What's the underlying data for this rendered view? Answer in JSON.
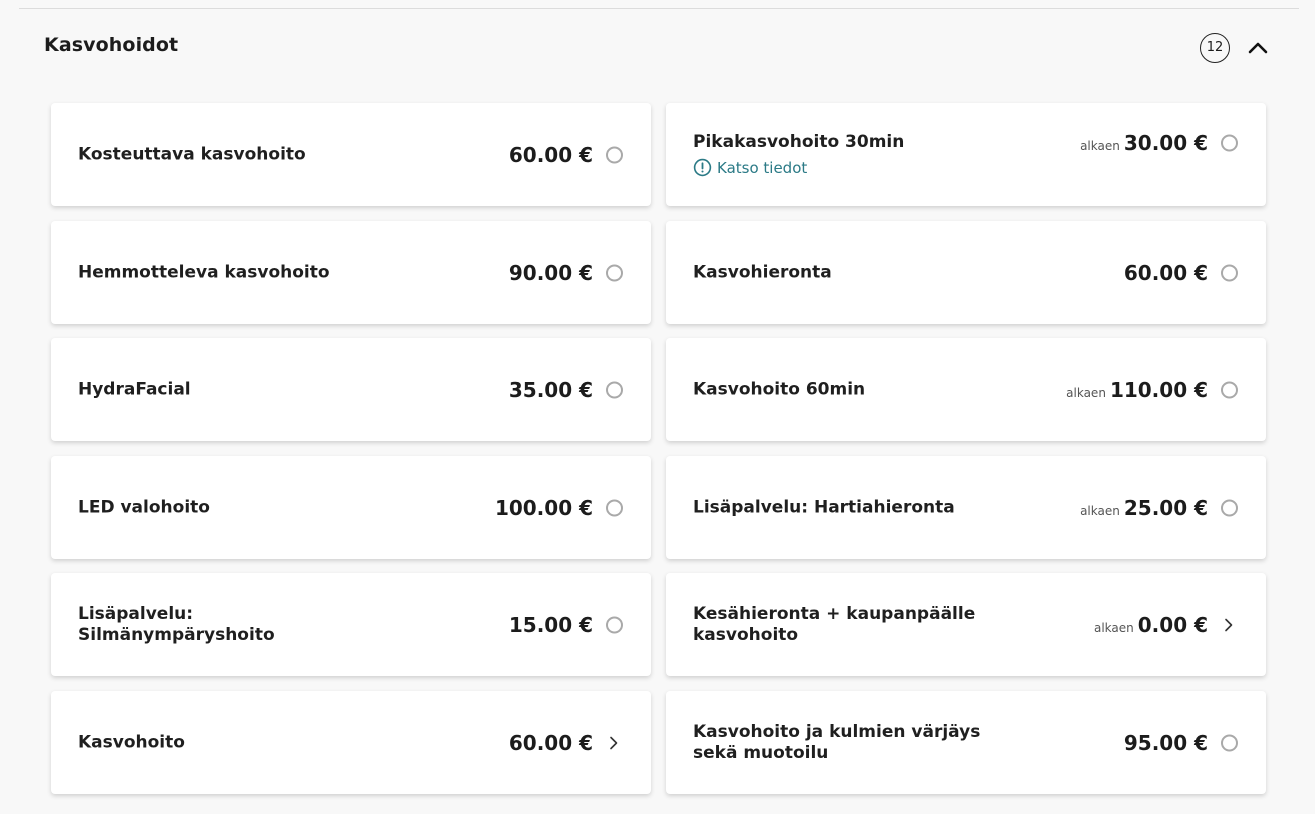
{
  "section": {
    "title": "Kasvohoidot",
    "count": "12"
  },
  "services": [
    {
      "name": "Kosteuttava kasvohoito",
      "price": "60.00 €",
      "from": "",
      "control": "radio",
      "details": ""
    },
    {
      "name": "Pikakasvohoito 30min",
      "price": "30.00 €",
      "from": "alkaen",
      "control": "radio",
      "details": "Katso tiedot"
    },
    {
      "name": "Hemmotteleva kasvohoito",
      "price": "90.00 €",
      "from": "",
      "control": "radio",
      "details": ""
    },
    {
      "name": "Kasvohieronta",
      "price": "60.00 €",
      "from": "",
      "control": "radio",
      "details": ""
    },
    {
      "name": "HydraFacial",
      "price": "35.00 €",
      "from": "",
      "control": "radio",
      "details": ""
    },
    {
      "name": "Kasvohoito 60min",
      "price": "110.00 €",
      "from": "alkaen",
      "control": "radio",
      "details": ""
    },
    {
      "name": "LED valohoito",
      "price": "100.00 €",
      "from": "",
      "control": "radio",
      "details": ""
    },
    {
      "name": "Lisäpalvelu: Hartiahieronta",
      "price": "25.00 €",
      "from": "alkaen",
      "control": "radio",
      "details": ""
    },
    {
      "name": "Lisäpalvelu: Silmänympäryshoito",
      "price": "15.00 €",
      "from": "",
      "control": "radio",
      "details": ""
    },
    {
      "name": "Kesähieronta + kaupanpäälle kasvohoito",
      "price": "0.00 €",
      "from": "alkaen",
      "control": "chevron",
      "details": ""
    },
    {
      "name": "Kasvohoito",
      "price": "60.00 €",
      "from": "",
      "control": "chevron",
      "details": ""
    },
    {
      "name": "Kasvohoito ja kulmien värjäys sekä muotoilu",
      "price": "95.00 €",
      "from": "",
      "control": "radio",
      "details": ""
    }
  ],
  "colors": {
    "accent": "#2b7a86",
    "radio_border": "#a9a9a9"
  },
  "icons": {
    "collapse": "chevron-up-icon",
    "details": "info-circle-icon",
    "expand": "chevron-right-icon"
  }
}
